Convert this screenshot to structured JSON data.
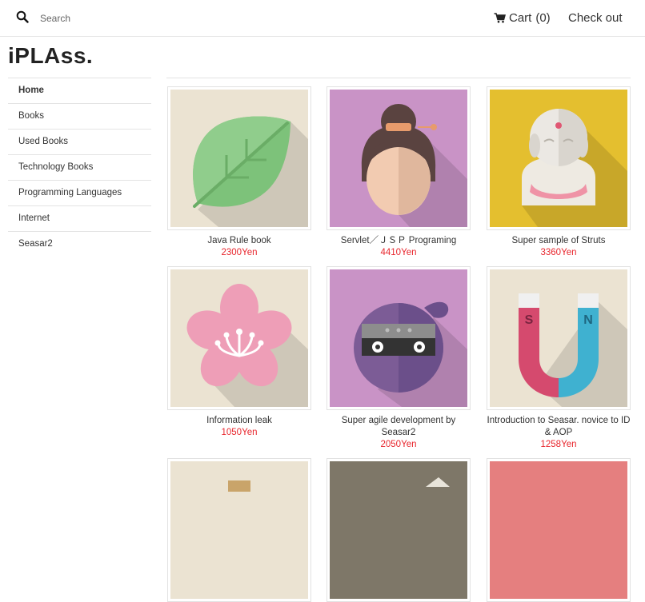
{
  "header": {
    "search_placeholder": "Search",
    "cart_label": "Cart",
    "cart_count": "(0)",
    "checkout_label": "Check out"
  },
  "logo": "iPLAss.",
  "sidebar": {
    "items": [
      {
        "label": "Home"
      },
      {
        "label": "Books"
      },
      {
        "label": "Used Books"
      },
      {
        "label": "Technology Books"
      },
      {
        "label": "Programming Languages"
      },
      {
        "label": "Internet"
      },
      {
        "label": "Seasar2"
      }
    ]
  },
  "products": [
    {
      "name": "Java Rule book",
      "price": "2300Yen",
      "icon": "leaf-icon",
      "bg": "#ebe3d2"
    },
    {
      "name": "Servlet／ＪＳＰ Programing",
      "price": "4410Yen",
      "icon": "geisha-icon",
      "bg": "#c993c6"
    },
    {
      "name": "Super sample of Struts",
      "price": "3360Yen",
      "icon": "jizo-statue-icon",
      "bg": "#e4bf2f"
    },
    {
      "name": "Information leak",
      "price": "1050Yen",
      "icon": "sakura-flower-icon",
      "bg": "#ebe3d2"
    },
    {
      "name": "Super agile development by Seasar2",
      "price": "2050Yen",
      "icon": "ninja-icon",
      "bg": "#c993c6"
    },
    {
      "name": "Introduction to Seasar. novice to ID & AOP",
      "price": "1258Yen",
      "icon": "magnet-icon",
      "bg": "#ebe3d2",
      "magnet_left": "S",
      "magnet_right": "N"
    },
    {
      "name": "",
      "price": "",
      "icon": "product-image-icon",
      "bg": "#ebe3d2"
    },
    {
      "name": "",
      "price": "",
      "icon": "product-image-icon",
      "bg": "#7e7768"
    },
    {
      "name": "",
      "price": "",
      "icon": "product-image-icon",
      "bg": "#e57f7f"
    }
  ],
  "colors": {
    "price": "#e8262d",
    "divider": "#e3e3e3"
  }
}
